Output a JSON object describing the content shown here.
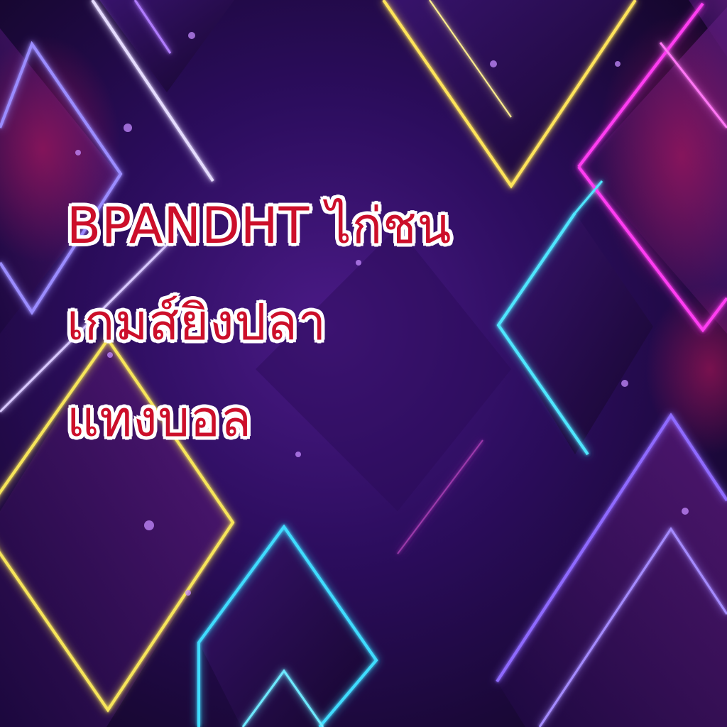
{
  "headline": {
    "line1": "BPANDHT ไก่ชน",
    "line2": "เกมส์ยิงปลา",
    "line3": "แทงบอล"
  },
  "colors": {
    "background": "#2c0d5e",
    "text_fill": "#cc0f2a",
    "text_outline": "#ffffff",
    "neon_yellow": "#ffe45a",
    "neon_cyan": "#4fe6ff",
    "neon_magenta": "#ff3df2",
    "neon_violet": "#8f6bff"
  }
}
